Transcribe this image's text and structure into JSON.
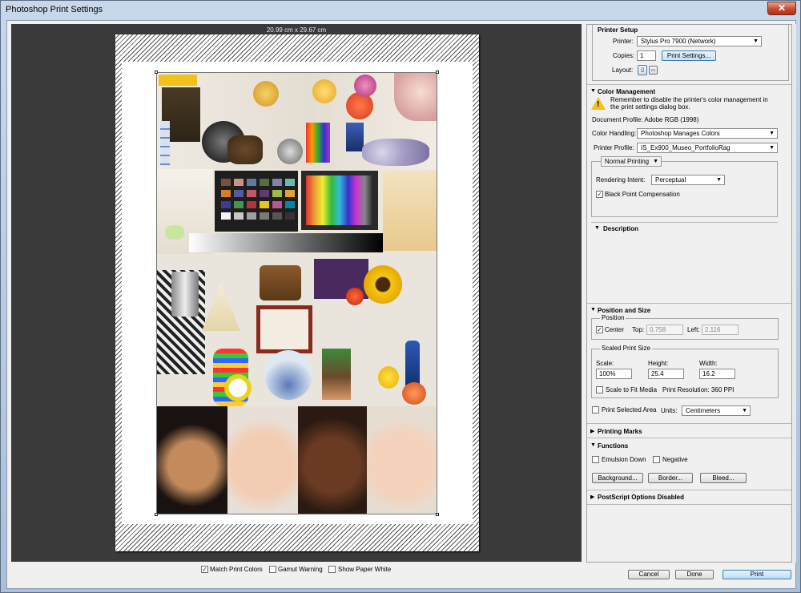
{
  "window": {
    "title": "Photoshop Print Settings",
    "close_glyph": "✕"
  },
  "preview": {
    "paper_size": "20.99 cm x 29.67 cm",
    "photo_icons": [
      "color-checker-chart",
      "portrait-faces",
      "still-life-shelves"
    ],
    "checkboxes": {
      "match_print_colors": {
        "label": "Match Print Colors",
        "checked": true
      },
      "gamut_warning": {
        "label": "Gamut Warning",
        "checked": false
      },
      "show_paper_white": {
        "label": "Show Paper White",
        "checked": false
      }
    }
  },
  "printer_setup": {
    "title": "Printer Setup",
    "printer_label": "Printer:",
    "printer_value": "Stylus Pro 7900 (Network)",
    "copies_label": "Copies:",
    "copies_value": "1",
    "print_settings_button": "Print Settings...",
    "layout_label": "Layout:"
  },
  "color_management": {
    "title": "Color Management",
    "warning": "Remember to disable the printer's color management in the print settings dialog box.",
    "document_profile": "Document Profile: Adobe RGB (1998)",
    "color_handling_label": "Color Handling:",
    "color_handling_value": "Photoshop Manages Colors",
    "printer_profile_label": "Printer Profile:",
    "printer_profile_value": "IS_Ex900_Museo_PortfolioRag",
    "printing_mode": "Normal Printing",
    "rendering_intent_label": "Rendering Intent:",
    "rendering_intent_value": "Perceptual",
    "black_point_label": "Black Point Compensation",
    "black_point_checked": true,
    "description_title": "Description"
  },
  "position_size": {
    "title": "Position and Size",
    "position_group": "Position",
    "center_label": "Center",
    "center_checked": true,
    "top_label": "Top:",
    "top_value": "0.758",
    "left_label": "Left:",
    "left_value": "2.116",
    "scaled_group": "Scaled Print Size",
    "scale_label": "Scale:",
    "scale_value": "100%",
    "height_label": "Height:",
    "height_value": "25.4",
    "width_label": "Width:",
    "width_value": "16.2",
    "scale_to_fit_label": "Scale to Fit Media",
    "print_resolution": "Print Resolution: 360 PPI",
    "print_selected_label": "Print Selected Area",
    "units_label": "Units:",
    "units_value": "Centimeters"
  },
  "printing_marks": {
    "title": "Printing Marks"
  },
  "functions": {
    "title": "Functions",
    "emulsion_down": "Emulsion Down",
    "negative": "Negative",
    "background_button": "Background...",
    "border_button": "Border...",
    "bleed_button": "Bleed..."
  },
  "postscript": {
    "title": "PostScript Options Disabled"
  },
  "footer": {
    "cancel": "Cancel",
    "done": "Done",
    "print": "Print"
  },
  "colors": {
    "print_button": "#cfe6fb",
    "accent_border": "#3c7fb1",
    "preview_bg": "#3a3a3a"
  }
}
